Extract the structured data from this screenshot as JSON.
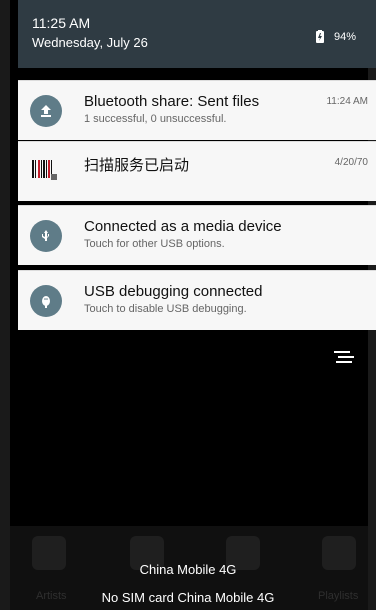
{
  "status": {
    "time": "11:25 AM",
    "date": "Wednesday, July 26",
    "battery": "94%"
  },
  "notifications": [
    {
      "title": "Bluetooth share: Sent files",
      "subtitle": "1 successful, 0 unsuccessful.",
      "time": "11:24 AM",
      "icon": "upload-icon"
    },
    {
      "title": "扫描服务已启动",
      "subtitle": "",
      "time": "4/20/70",
      "icon": "barcode-icon"
    },
    {
      "title": "Connected as a media device",
      "subtitle": "Touch for other USB options.",
      "time": "",
      "icon": "usb-icon"
    },
    {
      "title": "USB debugging connected",
      "subtitle": "Touch to disable USB debugging.",
      "time": "",
      "icon": "android-debug-icon"
    }
  ],
  "dock": {
    "labels": [
      "Artists",
      "Playlists"
    ]
  },
  "carrier": {
    "top": "China Mobile 4G",
    "bottom": "No SIM card  China Mobile 4G"
  }
}
